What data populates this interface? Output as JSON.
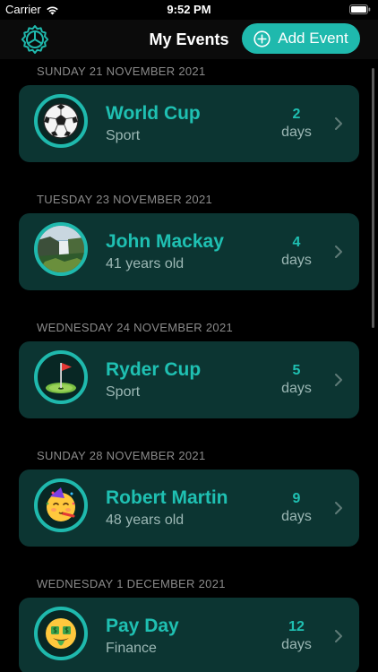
{
  "status_bar": {
    "carrier": "Carrier",
    "time": "9:52 PM"
  },
  "nav": {
    "title": "My Events",
    "add_event_label": "Add Event",
    "settings_icon": "gear-icon",
    "add_icon": "plus-circle-icon"
  },
  "colors": {
    "accent": "#1fb9ad",
    "card_bg": "#0c3532",
    "background": "#000000"
  },
  "events": [
    {
      "date": "SUNDAY 21 NOVEMBER 2021",
      "name": "World Cup",
      "subtitle": "Sport",
      "count": "2",
      "unit": "days",
      "icon": "soccer-ball-icon"
    },
    {
      "date": "TUESDAY 23 NOVEMBER 2021",
      "name": "John Mackay",
      "subtitle": "41 years old",
      "count": "4",
      "unit": "days",
      "icon": "waterfall-photo-icon"
    },
    {
      "date": "WEDNESDAY 24 NOVEMBER 2021",
      "name": "Ryder Cup",
      "subtitle": "Sport",
      "count": "5",
      "unit": "days",
      "icon": "golf-flag-icon"
    },
    {
      "date": "SUNDAY 28 NOVEMBER 2021",
      "name": "Robert Martin",
      "subtitle": "48 years old",
      "count": "9",
      "unit": "days",
      "icon": "party-face-icon"
    },
    {
      "date": "WEDNESDAY 1 DECEMBER 2021",
      "name": "Pay Day",
      "subtitle": "Finance",
      "count": "12",
      "unit": "days",
      "icon": "money-face-icon"
    }
  ]
}
